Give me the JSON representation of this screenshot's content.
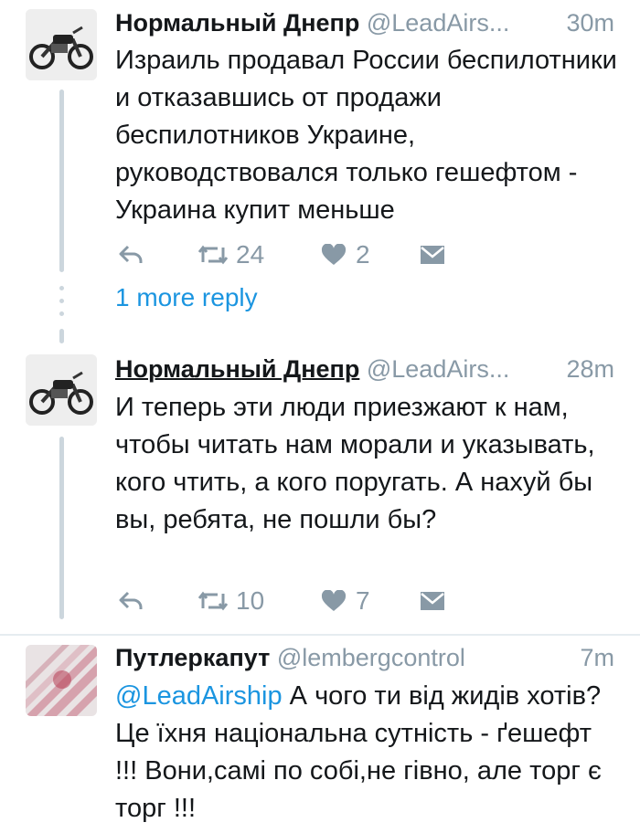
{
  "tweets": [
    {
      "name": "Нормальный Днепр",
      "handle": "@LeadAirs...",
      "time": "30m",
      "text": "Израиль продавал России беспилотники и отказавшись от продажи беспилотников Украине, руководствовался только гешефтом - Украина купит меньше",
      "retweets": "24",
      "likes": "2"
    },
    {
      "name": "Нормальный Днепр",
      "handle": "@LeadAirs...",
      "time": "28m",
      "text": "И теперь эти люди приезжают к нам, чтобы читать нам морали и указывать, кого чтить, а кого поругать. А нахуй бы вы, ребята, не пошли бы?",
      "retweets": "10",
      "likes": "7"
    },
    {
      "name": "Путлеркапут",
      "handle": "@lembergcontrol",
      "time": "7m",
      "mention": "@LeadAirship",
      "text": " А чого ти від жидів хотів? Це їхня національна сутність - ґешефт !!! Вони,самі по собі,не гівно, але торг є торг !!!"
    }
  ],
  "more_replies": "1 more reply",
  "icons": [
    "reply-icon",
    "retweet-icon",
    "heart-icon",
    "dm-icon"
  ]
}
